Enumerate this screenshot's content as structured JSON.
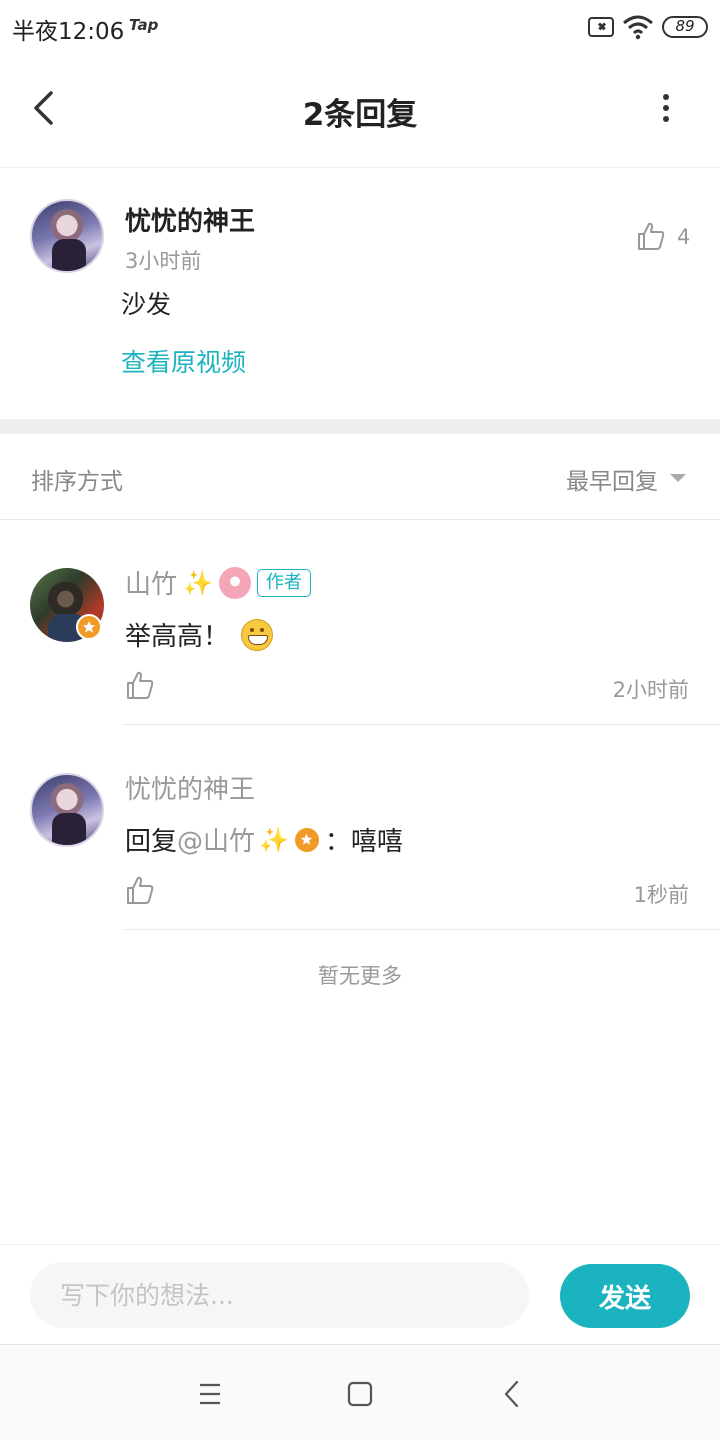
{
  "status_bar": {
    "time": "半夜12:06",
    "app_label": "Tap",
    "battery": "89",
    "icons": [
      "sim-error-icon",
      "wifi-icon",
      "battery-icon"
    ]
  },
  "header": {
    "title": "2条回复",
    "back_icon": "back-arrow-icon",
    "more_icon": "more-vertical-icon"
  },
  "main_comment": {
    "author": "忧忧的神王",
    "time": "3小时前",
    "text": "沙发",
    "link": "查看原视频",
    "like_count": "4"
  },
  "sort": {
    "label": "排序方式",
    "value": "最早回复"
  },
  "replies": [
    {
      "author": "山竹",
      "tag": "作者",
      "text": "举高高！",
      "time": "2小时前"
    },
    {
      "author": "忧忧的神王",
      "text_prefix": "回复",
      "mention": "@山竹",
      "text_suffix": "：嘻嘻",
      "time": "1秒前"
    }
  ],
  "footer_note": "暂无更多",
  "composer": {
    "placeholder": "写下你的想法...",
    "send_label": "发送"
  },
  "colors": {
    "accent": "#1ab3bf",
    "badge_orange": "#f29a27",
    "muted_text": "#999999"
  }
}
